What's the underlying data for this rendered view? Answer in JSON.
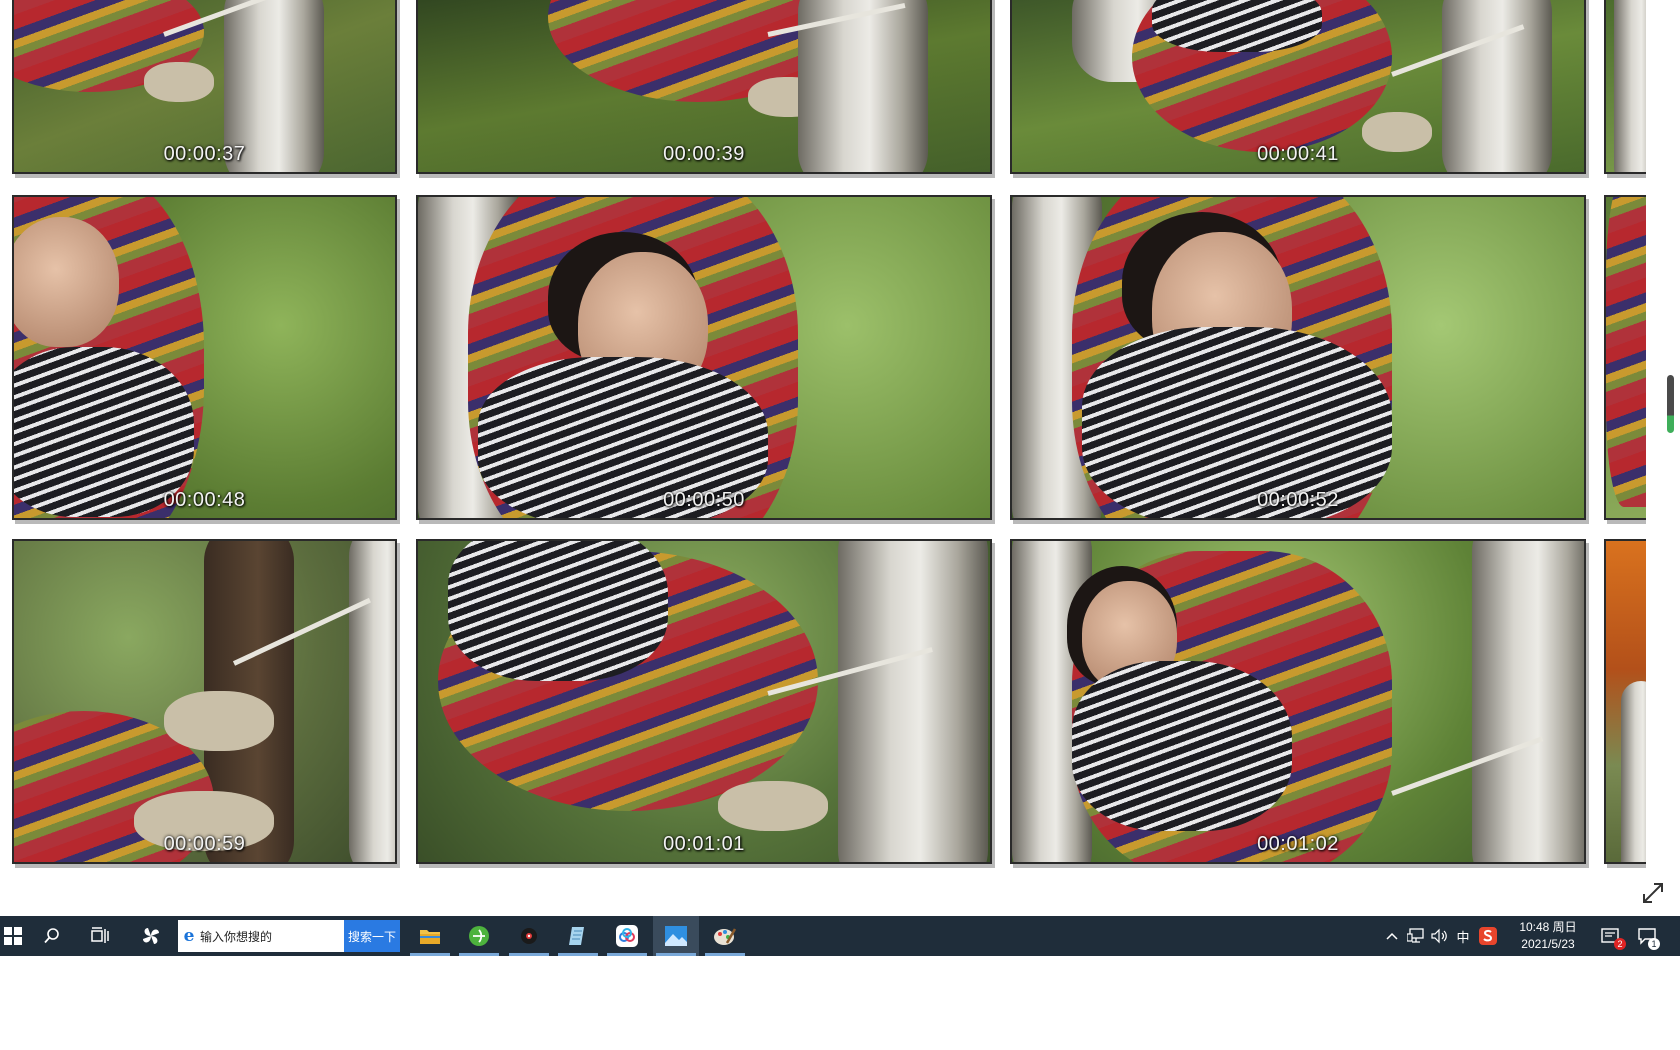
{
  "thumbnails": {
    "row1": [
      "00:00:37",
      "00:00:39",
      "00:00:41"
    ],
    "row2": [
      "00:00:48",
      "00:00:50",
      "00:00:52"
    ],
    "row3": [
      "00:00:59",
      "00:01:01",
      "00:01:02"
    ]
  },
  "taskbar": {
    "search_placeholder": "输入你想搜的",
    "search_button": "搜索一下",
    "apps": [
      "start-icon",
      "search-icon",
      "task-view-icon",
      "pinwheel-icon",
      "file-explorer-icon",
      "green-browser-icon",
      "media-player-icon",
      "notepad-icon",
      "baidu-netdisk-icon",
      "photos-icon",
      "paint-icon"
    ],
    "ime_label": "中",
    "time": "10:48 周日",
    "date": "2021/5/23",
    "security_badge": "2",
    "notification_badge": "1"
  },
  "colors": {
    "taskbar_bg": "#1f2d3a",
    "search_button_bg": "#2a7ae2",
    "active_indicator": "#79a8d8"
  }
}
